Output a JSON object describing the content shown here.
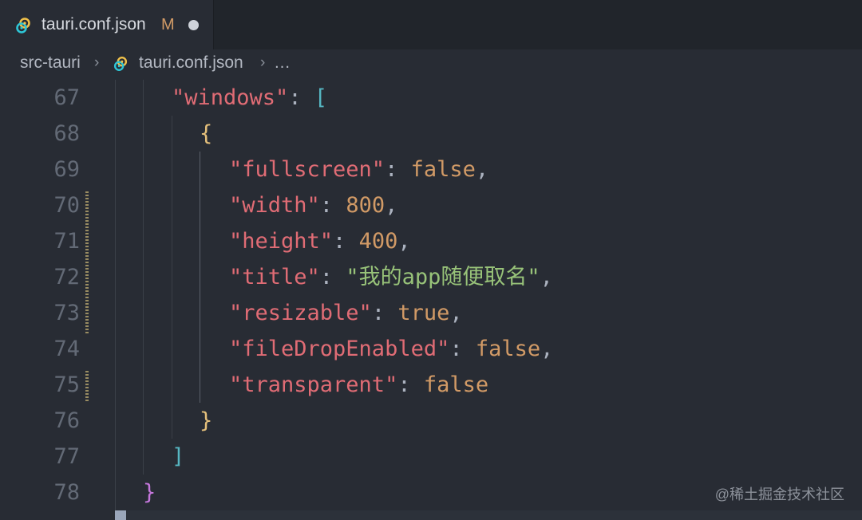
{
  "tab": {
    "file_name": "tauri.conf.json",
    "modified_badge": "M",
    "icon": "tauri-file-icon",
    "unsaved_indicator": "dot"
  },
  "breadcrumb": {
    "folder": "src-tauri",
    "file": "tauri.conf.json",
    "more": "…"
  },
  "editor": {
    "lines": [
      {
        "number": "67",
        "tokens": [
          [
            "key",
            "\"windows\""
          ],
          [
            "punc",
            ": "
          ],
          [
            "br1",
            "["
          ]
        ]
      },
      {
        "number": "68",
        "tokens": [
          [
            "br2",
            "{"
          ]
        ]
      },
      {
        "number": "69",
        "tokens": [
          [
            "key",
            "\"fullscreen\""
          ],
          [
            "punc",
            ": "
          ],
          [
            "bool",
            "false"
          ],
          [
            "punc",
            ","
          ]
        ]
      },
      {
        "number": "70",
        "tokens": [
          [
            "key",
            "\"width\""
          ],
          [
            "punc",
            ": "
          ],
          [
            "num",
            "800"
          ],
          [
            "punc",
            ","
          ]
        ]
      },
      {
        "number": "71",
        "tokens": [
          [
            "key",
            "\"height\""
          ],
          [
            "punc",
            ": "
          ],
          [
            "num",
            "400"
          ],
          [
            "punc",
            ","
          ]
        ]
      },
      {
        "number": "72",
        "tokens": [
          [
            "key",
            "\"title\""
          ],
          [
            "punc",
            ": "
          ],
          [
            "str",
            "\"我的app随便取名\""
          ],
          [
            "punc",
            ","
          ]
        ]
      },
      {
        "number": "73",
        "tokens": [
          [
            "key",
            "\"resizable\""
          ],
          [
            "punc",
            ": "
          ],
          [
            "bool",
            "true"
          ],
          [
            "punc",
            ","
          ]
        ]
      },
      {
        "number": "74",
        "tokens": [
          [
            "key",
            "\"fileDropEnabled\""
          ],
          [
            "punc",
            ": "
          ],
          [
            "bool",
            "false"
          ],
          [
            "punc",
            ","
          ]
        ]
      },
      {
        "number": "75",
        "tokens": [
          [
            "key",
            "\"transparent\""
          ],
          [
            "punc",
            ": "
          ],
          [
            "bool",
            "false"
          ]
        ]
      },
      {
        "number": "76",
        "tokens": [
          [
            "br2",
            "}"
          ]
        ]
      },
      {
        "number": "77",
        "tokens": [
          [
            "br1",
            "]"
          ]
        ]
      },
      {
        "number": "78",
        "tokens": [
          [
            "br3",
            "}"
          ]
        ]
      }
    ]
  },
  "watermark": "@稀土掘金技术社区",
  "colors": {
    "background": "#282c34",
    "key": "#e06c75",
    "boolean_number": "#d19a66",
    "string": "#98c379",
    "modified": "#d19a66"
  }
}
